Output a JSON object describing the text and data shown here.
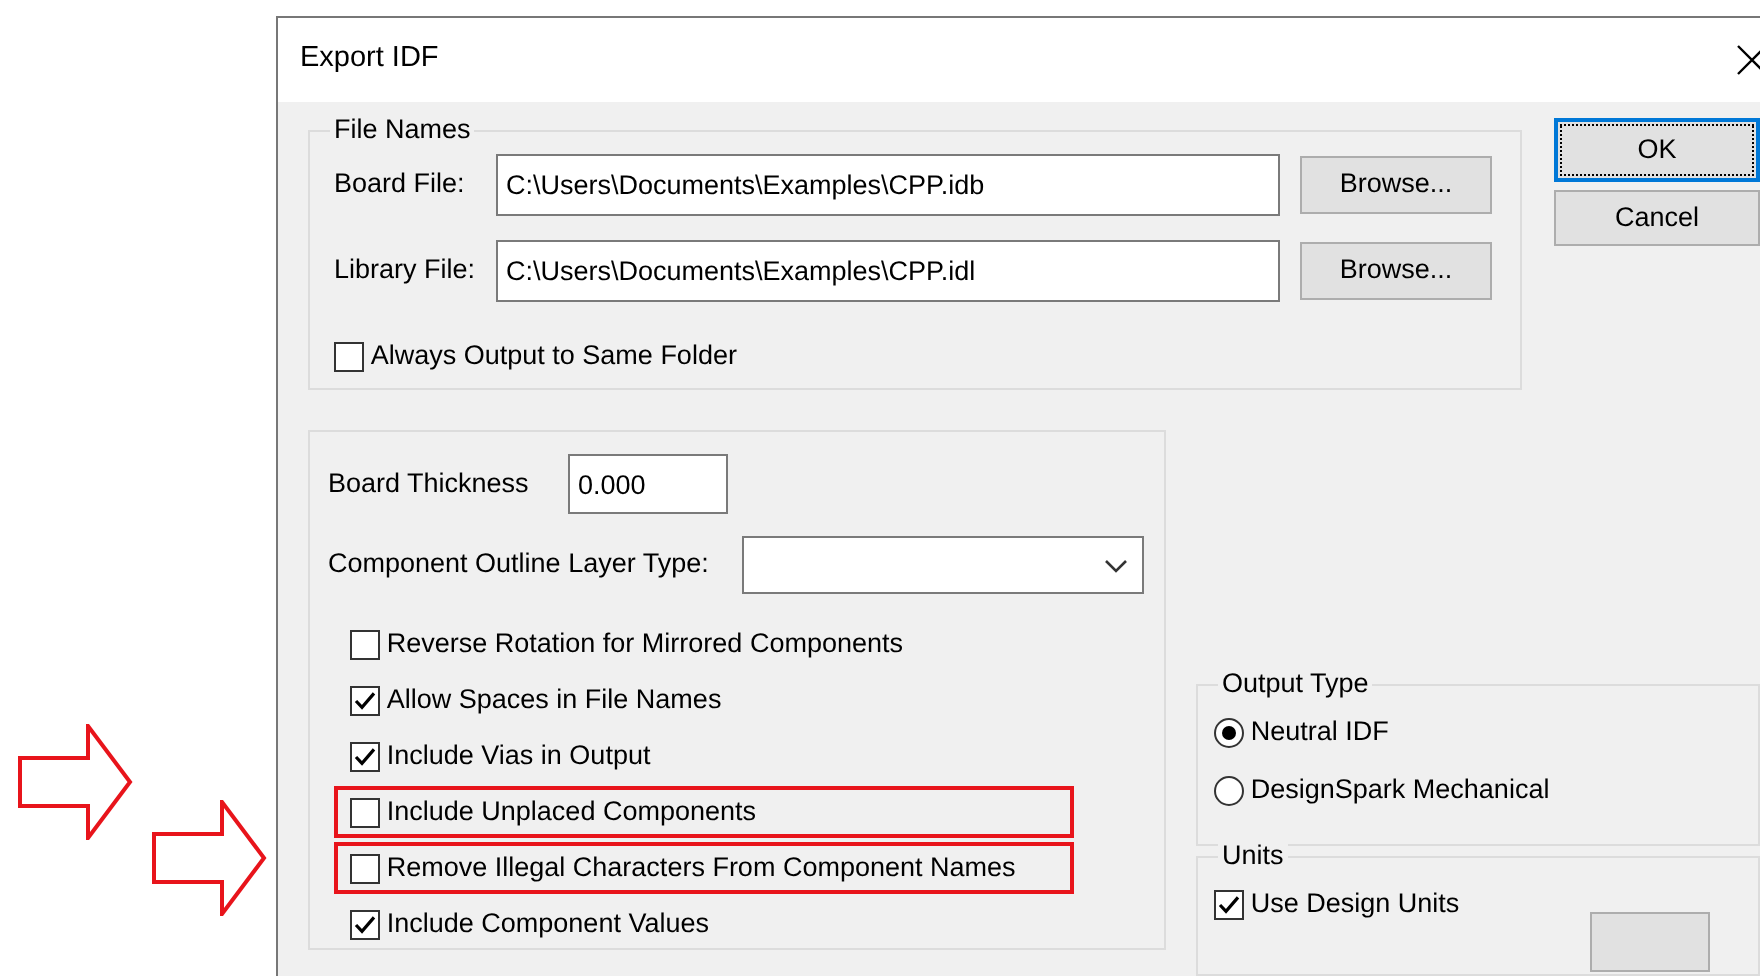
{
  "window": {
    "title": "Export IDF"
  },
  "file_names": {
    "label": "File Names",
    "fields": [
      {
        "label": "Board File:",
        "value": "C:\\Users\\Documents\\Examples\\CPP.idb",
        "button": "Browse..."
      },
      {
        "label": "Library File:",
        "value": "C:\\Users\\Documents\\Examples\\CPP.idl",
        "button": "Browse..."
      }
    ],
    "same_folder": {
      "label": "Always Output to Same Folder",
      "checked": false
    }
  },
  "buttons": [
    {
      "label": "OK",
      "default": true
    },
    {
      "label": "Cancel",
      "default": false
    }
  ],
  "options": {
    "thickness": {
      "label": "Board Thickness",
      "value": "0.000"
    },
    "layer_type": {
      "label": "Component Outline Layer Type:"
    },
    "checkboxes": [
      {
        "label": "Reverse Rotation for Mirrored Components",
        "checked": false,
        "highlighted": false
      },
      {
        "label": "Allow Spaces in File Names",
        "checked": true,
        "highlighted": false
      },
      {
        "label": "Include Vias in Output",
        "checked": true,
        "highlighted": false
      },
      {
        "label": "Include Unplaced Components",
        "checked": false,
        "highlighted": true
      },
      {
        "label": "Remove Illegal Characters From Component Names",
        "checked": false,
        "highlighted": true
      },
      {
        "label": "Include Component Values",
        "checked": true,
        "highlighted": false
      }
    ]
  },
  "output_type": {
    "label": "Output Type",
    "options": [
      {
        "label": "Neutral IDF",
        "selected": true
      },
      {
        "label": "DesignSpark Mechanical",
        "selected": false
      }
    ]
  },
  "units": {
    "label": "Units",
    "use_design_units": {
      "label": "Use Design Units",
      "checked": true
    }
  }
}
